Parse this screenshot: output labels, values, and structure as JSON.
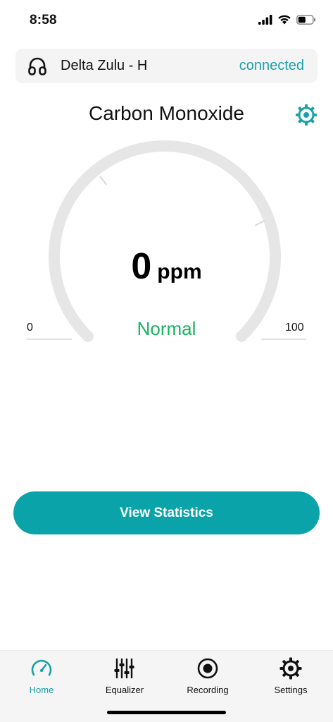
{
  "status_bar": {
    "time": "8:58",
    "icons": [
      "cellular-signal-icon",
      "wifi-icon",
      "battery-icon"
    ]
  },
  "device": {
    "name": "Delta Zulu - H",
    "status": "connected",
    "icon": "headphones-icon"
  },
  "sensor": {
    "title": "Carbon Monoxide",
    "settings_icon": "gear-icon"
  },
  "gauge": {
    "value": "0",
    "unit": "ppm",
    "status": "Normal",
    "min_label": "0",
    "max_label": "100",
    "level_fraction": 0
  },
  "actions": {
    "view_statistics": "View Statistics"
  },
  "tabs": [
    {
      "label": "Home",
      "icon": "speedometer-icon",
      "active": true
    },
    {
      "label": "Equalizer",
      "icon": "equalizer-sliders-icon",
      "active": false
    },
    {
      "label": "Recording",
      "icon": "record-icon",
      "active": false
    },
    {
      "label": "Settings",
      "icon": "gear-icon",
      "active": false
    }
  ],
  "colors": {
    "accent": "#0aa3a9",
    "accent_text": "#1aa1a8",
    "normal_status": "#19b261",
    "gauge_track": "#e6e6e6"
  }
}
